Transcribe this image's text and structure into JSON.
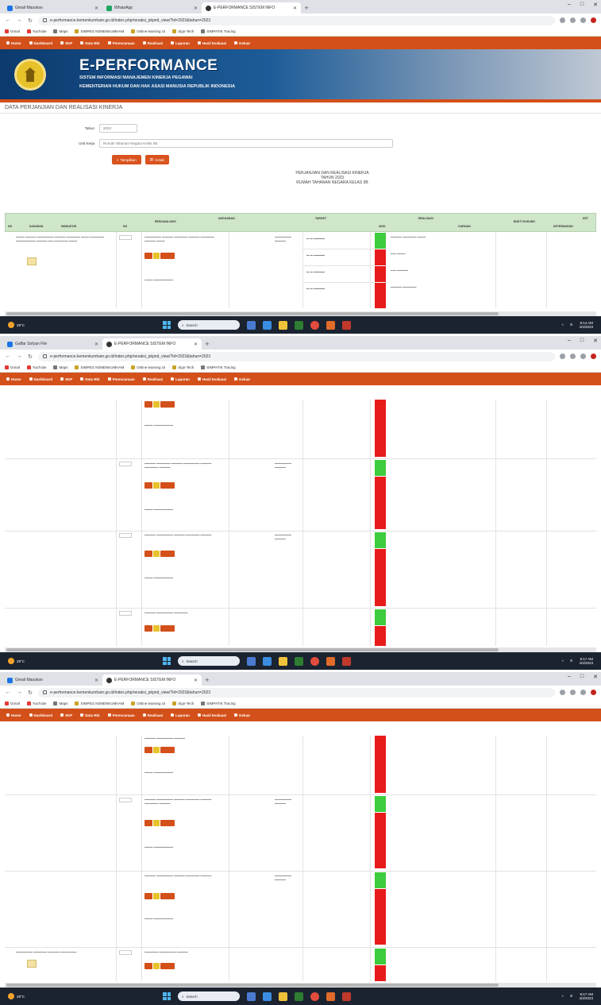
{
  "browser": {
    "tabs_shot1": [
      {
        "title": "Gmail Masukan",
        "active": false
      },
      {
        "title": "WhatsApp",
        "active": false
      },
      {
        "title": "E-PERFORMANCE SISTEM INFO",
        "active": true
      }
    ],
    "tabs_shot2": [
      {
        "title": "Gaffar Sofyan File",
        "active": false
      },
      {
        "title": "E-PERFORMANCE SISTEM INFO",
        "active": true
      }
    ],
    "tabs_shot3": [
      {
        "title": "Gmail Masukan",
        "active": false
      },
      {
        "title": "E-PERFORMANCE SISTEM INFO",
        "active": true
      }
    ],
    "url": "e-performance.kemenkumham.go.id/index.php/renaksi_pkpnd_view/?id=2023&tahun=2023",
    "bookmarks": [
      "Gmail",
      "YouTube",
      "Maps",
      "SIMPEG KEMENKUMHAM",
      "Online learning UI",
      "Sign-Tech",
      "SIMPATIK Tracing"
    ]
  },
  "app": {
    "nav": [
      "Home",
      "Dashboard",
      "SKP",
      "Data Rkt",
      "Perencanaan",
      "Realisasi",
      "Laporan",
      "Hasil Evaluasi",
      "Keluar"
    ],
    "banner_title": "E-PERFORMANCE",
    "banner_sub1": "SISTEM INFORMASI MANAJEMEN KINERJA PEGAWAI",
    "banner_sub2": "KEMENTERIAN HUKUM DAN HAK ASASI MANUSIA REPUBLIK INDONESIA",
    "page_title": "DATA PERJANJIAN DAN REALISASI KINERJA"
  },
  "filter": {
    "year_label": "Tahun",
    "year_value": "2023",
    "unit_label": "Unit Kerja",
    "unit_value": "Rumah Tahanan Negara Kelas IIB",
    "search_label": "Tampilkan",
    "export_label": "Cetak"
  },
  "report": {
    "line1": "PERJANJIAN DAN REALISASI KINERJA",
    "line2": "TAHUN 2023",
    "line3": "RUMAH TAHANAN NEGARA KELAS IIB"
  },
  "table": {
    "headers": [
      "No",
      "Sasaran",
      "Indikator",
      "No",
      "Rencana Aksi",
      "Anggaran",
      "Target",
      "Realisasi",
      "Aksi",
      "Capaian",
      "Bukti Dukung",
      "Keterangan",
      "Ket"
    ]
  },
  "taskbar": {
    "temp": "29°C",
    "weather": "Cerah",
    "search": "Search",
    "time_1": "9:14 AM",
    "date_1": "4/4/2023",
    "time_2": "9:17 AM",
    "date_2": "4/4/2023",
    "time_3": "9:17 AM",
    "date_3": "4/4/2023"
  },
  "colors": {
    "brand": "#d4501a",
    "table_header": "#cfe6c8",
    "status_ok": "#3dcc3d",
    "status_bad": "#e81b1b"
  }
}
